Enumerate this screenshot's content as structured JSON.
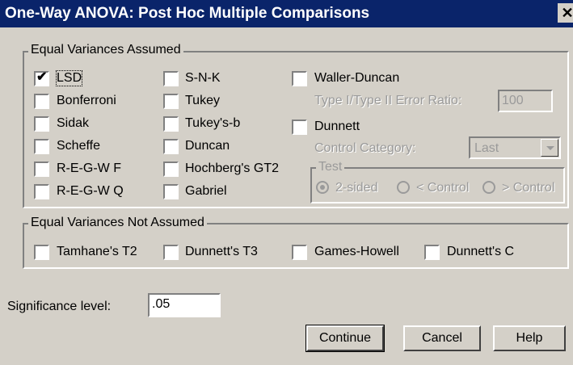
{
  "window": {
    "title": "One-Way ANOVA: Post Hoc Multiple Comparisons",
    "close_glyph": "✕"
  },
  "equal_assumed": {
    "legend": "Equal Variances Assumed",
    "col1": [
      {
        "label": "LSD",
        "checked": true
      },
      {
        "label": "Bonferroni",
        "checked": false
      },
      {
        "label": "Sidak",
        "checked": false
      },
      {
        "label": "Scheffe",
        "checked": false
      },
      {
        "label": "R-E-G-W F",
        "checked": false
      },
      {
        "label": "R-E-G-W Q",
        "checked": false
      }
    ],
    "col2": [
      {
        "label": "S-N-K",
        "checked": false
      },
      {
        "label": "Tukey",
        "checked": false
      },
      {
        "label": "Tukey's-b",
        "checked": false
      },
      {
        "label": "Duncan",
        "checked": false
      },
      {
        "label": "Hochberg's GT2",
        "checked": false
      },
      {
        "label": "Gabriel",
        "checked": false
      }
    ],
    "waller_duncan": {
      "label": "Waller-Duncan",
      "checked": false
    },
    "error_ratio": {
      "label": "Type I/Type II Error Ratio:",
      "value": "100"
    },
    "dunnett": {
      "label": "Dunnett",
      "checked": false
    },
    "control_category": {
      "label": "Control Category:",
      "value": "Last"
    },
    "test": {
      "legend": "Test",
      "options": [
        {
          "label": "2-sided",
          "selected": true
        },
        {
          "label": "< Control",
          "selected": false
        },
        {
          "label": "> Control",
          "selected": false
        }
      ]
    }
  },
  "equal_not_assumed": {
    "legend": "Equal Variances Not Assumed",
    "items": [
      {
        "label": "Tamhane's T2",
        "checked": false
      },
      {
        "label": "Dunnett's T3",
        "checked": false
      },
      {
        "label": "Games-Howell",
        "checked": false
      },
      {
        "label": "Dunnett's C",
        "checked": false
      }
    ]
  },
  "significance": {
    "label": "Significance level:",
    "value": ".05"
  },
  "buttons": {
    "continue": "Continue",
    "cancel": "Cancel",
    "help": "Help"
  }
}
